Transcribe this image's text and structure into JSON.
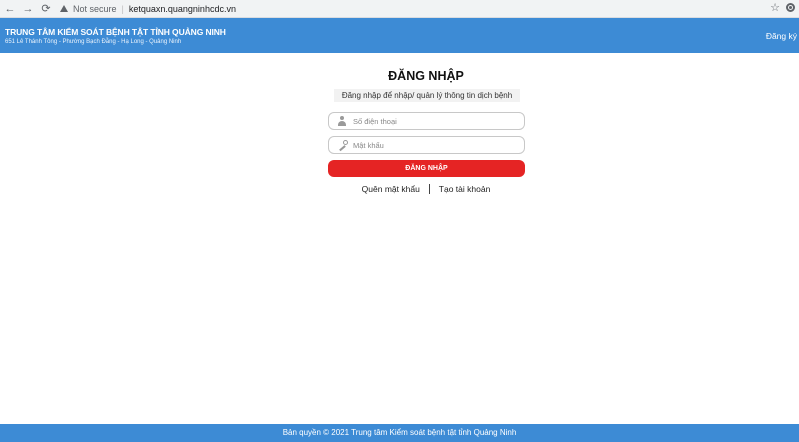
{
  "browser": {
    "back": "←",
    "forward": "→",
    "reload": "⟳",
    "security": "Not secure",
    "separator": "|",
    "url": "ketquaxn.quangninhcdc.vn",
    "star": "☆"
  },
  "header": {
    "org_name": "TRUNG TÂM KIỂM SOÁT BỆNH TẬT TỈNH QUẢNG NINH",
    "address": "651 Lê Thánh Tông - Phường Bạch Đằng - Hạ Long - Quảng Ninh",
    "register_label": "Đăng ký"
  },
  "login": {
    "title": "ĐĂNG NHẬP",
    "subtitle": "Đăng nhập để nhập/ quản lý thông tin dịch bệnh",
    "phone_placeholder": "Số điện thoại",
    "password_placeholder": "Mật khẩu",
    "button_label": "ĐĂNG NHẬP",
    "forgot_label": "Quên mật khẩu",
    "create_label": "Tạo tài khoản"
  },
  "footer": {
    "copyright": "Bản quyền © 2021 Trung tâm Kiểm soát bệnh tật tỉnh Quảng Ninh"
  },
  "colors": {
    "header_bg": "#3d8bd5",
    "button_bg": "#e52424"
  }
}
